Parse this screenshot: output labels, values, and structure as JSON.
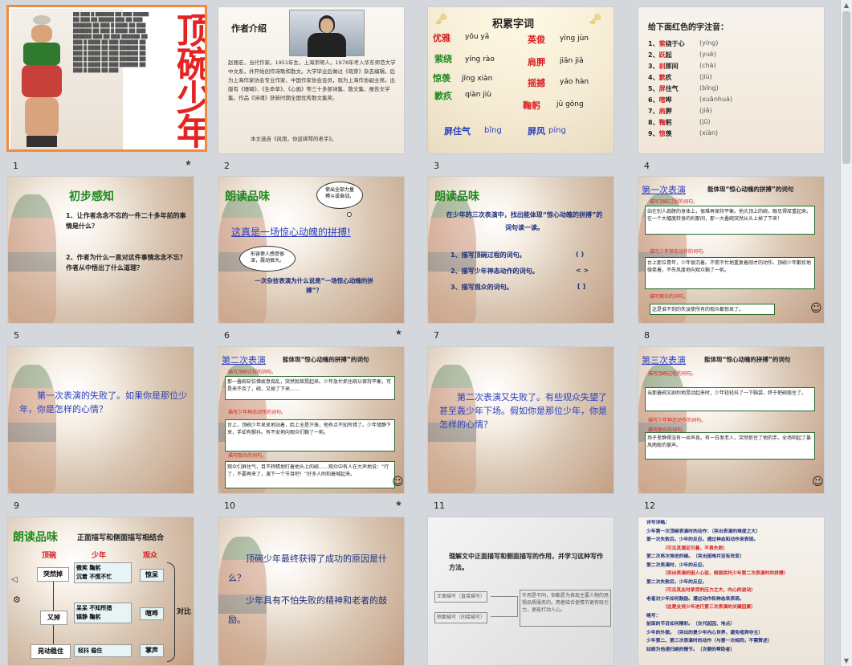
{
  "slides": [
    {
      "num": "1",
      "title": "顶碗少年"
    },
    {
      "num": "2",
      "heading": "作者介绍",
      "body": "赵丽宏，当代作家。1951年生，上海崇明人。1978年考入华东师范大学中文系，并开始创作诗歌和散文。大学毕业后做过《萌芽》杂志编辑。后为上海作家协会专业作家、中国作家协会会员，现为上海作协副主席。出版有《珊瑚》、《生命草》、《心画》等三十多部诗集、散文集、报告文学集。作品《诗魂》获新时期全国优秀散文集奖。",
      "note": "本文选自《风雨，你这绑琴的老手》。"
    },
    {
      "num": "3",
      "heading": "积累字词",
      "words": [
        {
          "w": "优雅",
          "p": "yōu yǎ"
        },
        {
          "w": "英俊",
          "p": "yīng jùn"
        },
        {
          "w": "萦绕",
          "p": "yíng rào"
        },
        {
          "w": "肩胛",
          "p": "jiān jiǎ"
        },
        {
          "w": "惊羡",
          "p": "jīng xiàn"
        },
        {
          "w": "摇撼",
          "p": "yáo hàn"
        },
        {
          "w": "歉疚",
          "p": "qiàn jiù"
        },
        {
          "w": "鞠躬",
          "p": "jū gōng"
        },
        {
          "w": "屏住气",
          "p": "bǐng"
        },
        {
          "w": "屏风",
          "p": "píng"
        }
      ]
    },
    {
      "num": "4",
      "heading": "给下面红色的字注音：",
      "items": [
        {
          "n": "1、",
          "r": "萦",
          "rest": "绕于心",
          "py": "(yíng)"
        },
        {
          "n": "2、",
          "r": "跃",
          "rest": "起",
          "py": "(yuè)"
        },
        {
          "n": "3、",
          "r": "刹",
          "rest": "那间",
          "py": "(chà)"
        },
        {
          "n": "4、",
          "r": "歉",
          "rest": "疚",
          "py": "(jiù)"
        },
        {
          "n": "5、",
          "r": "屏",
          "rest": "住气",
          "py": "(bǐng)"
        },
        {
          "n": "6、",
          "r": "喧",
          "rest": "哗",
          "py": "(xuānhuá)"
        },
        {
          "n": "7、",
          "r": "肩",
          "rest": "胛",
          "py": "(jiǎ)"
        },
        {
          "n": "8、",
          "r": "鞠",
          "rest": "躬",
          "py": "(jū)"
        },
        {
          "n": "9、",
          "r": "惊",
          "rest": "羡",
          "py": "(xiàn)"
        }
      ]
    },
    {
      "num": "5",
      "heading": "初步感知",
      "q1": "1、让作者念念不忘的一件二十多年前的事情是什么？",
      "q2": "2、作者为什么一直对这件事情念念不忘？作者从中悟出了什么道理？"
    },
    {
      "num": "6",
      "heading": "朗读品味",
      "line": "这真是一场惊心动魄的拼搏!",
      "bubble1": "使出全部力量搏斗或奋战。",
      "bubble2": "形容使人感受很深，震动很大。",
      "q": "一次杂技表演为什么说是“一场惊心动魄的拼搏”？"
    },
    {
      "num": "7",
      "heading": "朗读品味",
      "intro": "在少年的三次表演中，找出能体现“惊心动魄的拼搏”的词句读一读。",
      "tasks": [
        {
          "t": "1、描写顶碗过程的词句。",
          "m": "( )"
        },
        {
          "t": "2、描写少年神态动作的词句。",
          "m": "< >"
        },
        {
          "t": "3、描写观众的词句。",
          "m": "[ ]"
        }
      ]
    },
    {
      "num": "8",
      "heading": "第一次表演",
      "sub": "能体现“惊心动魄的拼搏”的词句",
      "l1": "描写顶碗过程的词句。",
      "b1": "站在别人肩膀的身体上，很难再保持平衡。他头顶上的碗，眼见得厚重起来。在一个大幅度转身的刹那间，那一大叠碗突然从头上掉了下来！",
      "l2": "描写少年神态动作的词句。",
      "b2": "台上那位青年，少年很沉着。不慌不忙地重复着刚才的动作。顶碗少年歉疚地微笑着，不失风度地向观众鞠了一躬。",
      "l3": "描写观众的词句。",
      "b3": "这是谁不到的失误使所有的观众都惊呆了。"
    },
    {
      "num": "9",
      "text": "第一次表演的失败了。如果你是那位少年，你是怎样的心情？"
    },
    {
      "num": "10",
      "heading": "第二次表演",
      "sub": "能体现“惊心动魄的拼搏”的词句",
      "l1": "描写顶碗过程的词句。",
      "b1": "那一叠碗却仿佛故意捣乱，突然就摇晃起来。少年急忙抓住碗以保持平衡，可是来不及了，碗，又掉了下来……",
      "l2": "描写少年神态动作的词句。",
      "b2": "台上，顶碗少年呆呆地站着，脸上全是汗珠，他有点不知所措了。少年镇静下来，手却有颤抖。有不安地向观众们鞠了一躬。",
      "l3": "描写观众的词句。",
      "b3": "观众们屏住气，目不转睛地盯着他头上的碗……观众中有人在大声地说：“行了，不要再来了，演下一个节目吧！”好多人附和着喊起来。"
    },
    {
      "num": "11",
      "text": "第二次表演又失败了。有些观众失望了甚至轰少年下场。假如你是那位少年，你是怎样的心情？"
    },
    {
      "num": "12",
      "heading": "第三次表演",
      "sub": "能体现“惊心动魄的拼搏”的词句",
      "l1": "描写顶碗过程的词句。",
      "b1": "当那叠碗又剧烈地晃动起来时，少年轻轻抖了一下脑袋，终于把碗稳住了。",
      "l2": "描写少年神态动作的词句。",
      "b2": "",
      "l3": "描写观众的词句。",
      "b3": "场子里静得没有一丝声息。有一白发老人，突然抓住了他的手。全场响起了暴风雨般的掌声。"
    },
    {
      "num": "13",
      "heading": "朗读品味",
      "sub": "正面描写和侧面描写相结合",
      "cols": [
        "顶碗",
        "少年",
        "观众"
      ],
      "b1": "突然掉",
      "b2": "又掉",
      "b3": "晃动稳住",
      "m1": "微笑 鞠躬\n沉着 不慌不忙",
      "m2": "呆呆 不知所措\n镇静 鞠躬",
      "m3": "轻抖 稳住",
      "o1": "惊呆",
      "o2": "喧哗",
      "o3": "掌声",
      "dui": "对比"
    },
    {
      "num": "14",
      "q": "顶碗少年最终获得了成功的原因是什么？",
      "a": "少年具有不怕失败的精神和老者的鼓励。"
    },
    {
      "num": "15",
      "title": "理解文中正面描写和侧面描写的作用，并学习这种写作方法。",
      "left1": "正面描写（直接描写）",
      "left2": "侧面描写（间接描写）",
      "right": "作用是不同，但都是为表现主要人物的思想品质服务的。两者结合使情节更有吸引力，更能打动人心。"
    },
    {
      "num": "16",
      "lines": [
        "详写详略：",
        "少年第一次顶碗表演时的动作：（突出表演的难度之大）",
        "第一次失败后，少年的反应。通过神态和动作来表现。",
        "（可见其镇定沉着，不畏失败）",
        "第二次再次堆进的碗。（突出困难并没有改变）",
        "第二次表演时，少年的反应。",
        "（突出表演的困人心弦，侧面烘托少年第二次表演时的拼搏）",
        "第二次失败后，少年的反应。",
        "（可见其此时承受的压力之大，内心的波动）",
        "老者对少年如何鼓励。通过动作和神态来表现。",
        "（这是支持少年进行第三次表演的关键因素）",
        "略写：",
        "前面的节目如何精彩。（交代起因、地点）",
        "少年的外貌。（突出的是少年内心世界，避免喧宾夺主）",
        "少年第二、第三次表演时的动作（与第一次相同，不需赘述）",
        "姑娘为他递归碗的情节。（次要的帮助者）"
      ]
    }
  ]
}
